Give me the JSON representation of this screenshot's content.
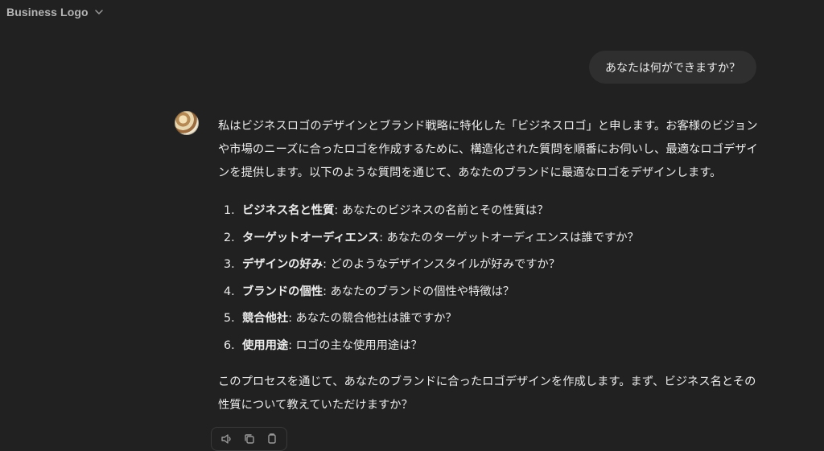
{
  "header": {
    "title": "Business Logo",
    "dropdown_icon": "chevron-down-icon"
  },
  "user_message": {
    "text": "あなたは何ができますか？"
  },
  "assistant": {
    "avatar": "assistant-avatar",
    "intro": "私はビジネスロゴのデザインとブランド戦略に特化した「ビジネスロゴ」と申します。お客様のビジョンや市場のニーズに合ったロゴを作成するために、構造化された質問を順番にお伺いし、最適なロゴデザインを提供します。以下のような質問を通じて、あなたのブランドに最適なロゴをデザインします。",
    "list": [
      {
        "num": "1.",
        "term": "ビジネス名と性質",
        "desc": ": あなたのビジネスの名前とその性質は？"
      },
      {
        "num": "2.",
        "term": "ターゲットオーディエンス",
        "desc": ": あなたのターゲットオーディエンスは誰ですか？"
      },
      {
        "num": "3.",
        "term": "デザインの好み",
        "desc": ": どのようなデザインスタイルが好みですか？"
      },
      {
        "num": "4.",
        "term": "ブランドの個性",
        "desc": ": あなたのブランドの個性や特徴は？"
      },
      {
        "num": "5.",
        "term": "競合他社",
        "desc": ": あなたの競合他社は誰ですか？"
      },
      {
        "num": "6.",
        "term": "使用用途",
        "desc": ": ロゴの主な使用用途は？"
      }
    ],
    "outro": "このプロセスを通じて、あなたのブランドに合ったロゴデザインを作成します。まず、ビジネス名とその性質について教えていただけますか？"
  },
  "actions": {
    "items": [
      "speaker-icon",
      "copy-icon",
      "regenerate-icon"
    ]
  }
}
